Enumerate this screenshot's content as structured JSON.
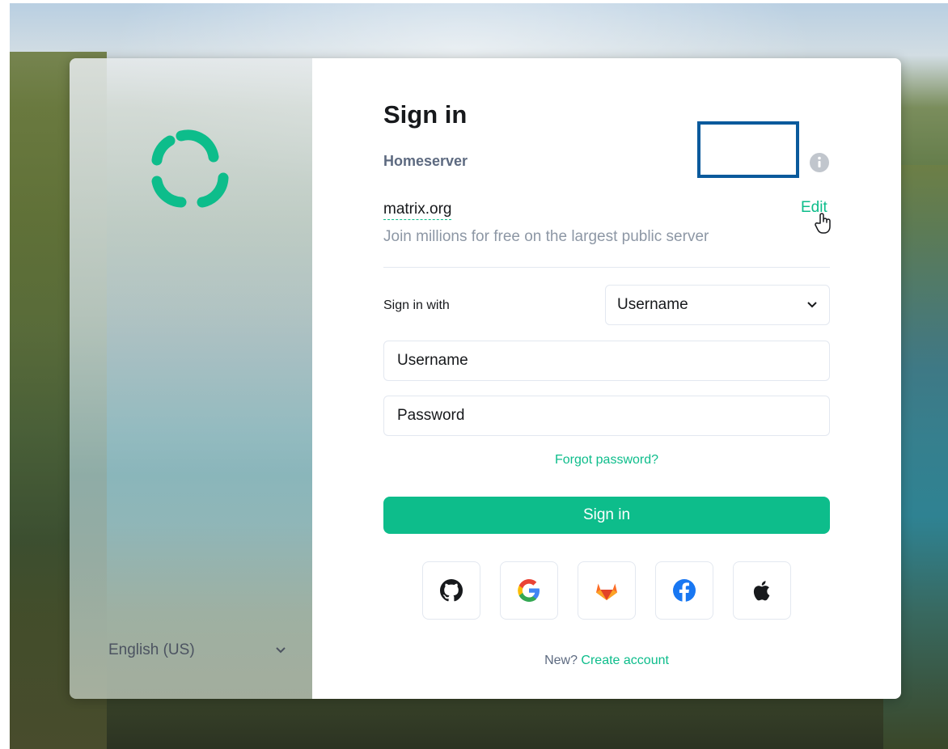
{
  "colors": {
    "accent": "#0dbd8b",
    "highlight_box": "#0a5a9c",
    "text_primary": "#17191c",
    "text_secondary": "#8d97a5"
  },
  "sidebar": {
    "logo_icon": "element-logo-icon",
    "language": "English (US)"
  },
  "form": {
    "title": "Sign in",
    "homeserver_label": "Homeserver",
    "info_icon": "info-icon",
    "homeserver_value": "matrix.org",
    "homeserver_description": "Join millions for free on the largest public server",
    "edit_label": "Edit",
    "sign_in_with_label": "Sign in with",
    "sign_in_with_value": "Username",
    "username_placeholder": "Username",
    "password_placeholder": "Password",
    "forgot_password": "Forgot password?",
    "submit_label": "Sign in"
  },
  "sso": [
    {
      "icon": "github-icon"
    },
    {
      "icon": "google-icon"
    },
    {
      "icon": "gitlab-icon"
    },
    {
      "icon": "facebook-icon"
    },
    {
      "icon": "apple-icon"
    }
  ],
  "footer": {
    "new_prompt": "New?",
    "create_account": "Create account"
  }
}
